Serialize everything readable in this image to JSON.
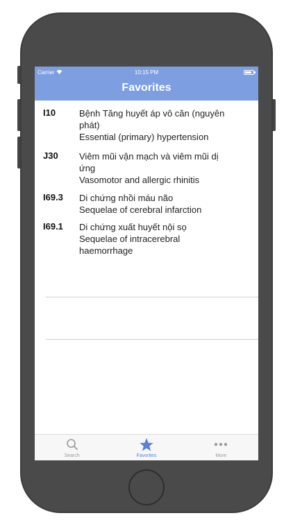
{
  "status_bar": {
    "carrier": "Carrier",
    "time": "10:15 PM"
  },
  "nav": {
    "title": "Favorites"
  },
  "favorites": [
    {
      "code": "I10",
      "vi": "Bệnh Tăng huyết áp vô căn (nguyên phát)",
      "en": "Essential (primary) hypertension"
    },
    {
      "code": "J30",
      "vi": "Viêm mũi vận mạch và viêm mũi dị ứng",
      "en": "Vasomotor and allergic rhinitis"
    },
    {
      "code": "I69.3",
      "vi": "Di chứng nhồi máu não",
      "en": "Sequelae of cerebral infarction"
    },
    {
      "code": "I69.1",
      "vi": "Di chứng xuất huyết nội sọ",
      "en": "Sequelae of intracerebral haemorrhage"
    }
  ],
  "tabbar": {
    "items": [
      {
        "label": "Search",
        "icon": "search-icon",
        "active": false
      },
      {
        "label": "Favorites",
        "icon": "star-icon",
        "active": true
      },
      {
        "label": "More",
        "icon": "more-icon",
        "active": false
      }
    ]
  },
  "colors": {
    "nav_bar": "#7d9ee0",
    "tab_active": "#5a80d8",
    "phone_body": "#4a4a4a"
  }
}
